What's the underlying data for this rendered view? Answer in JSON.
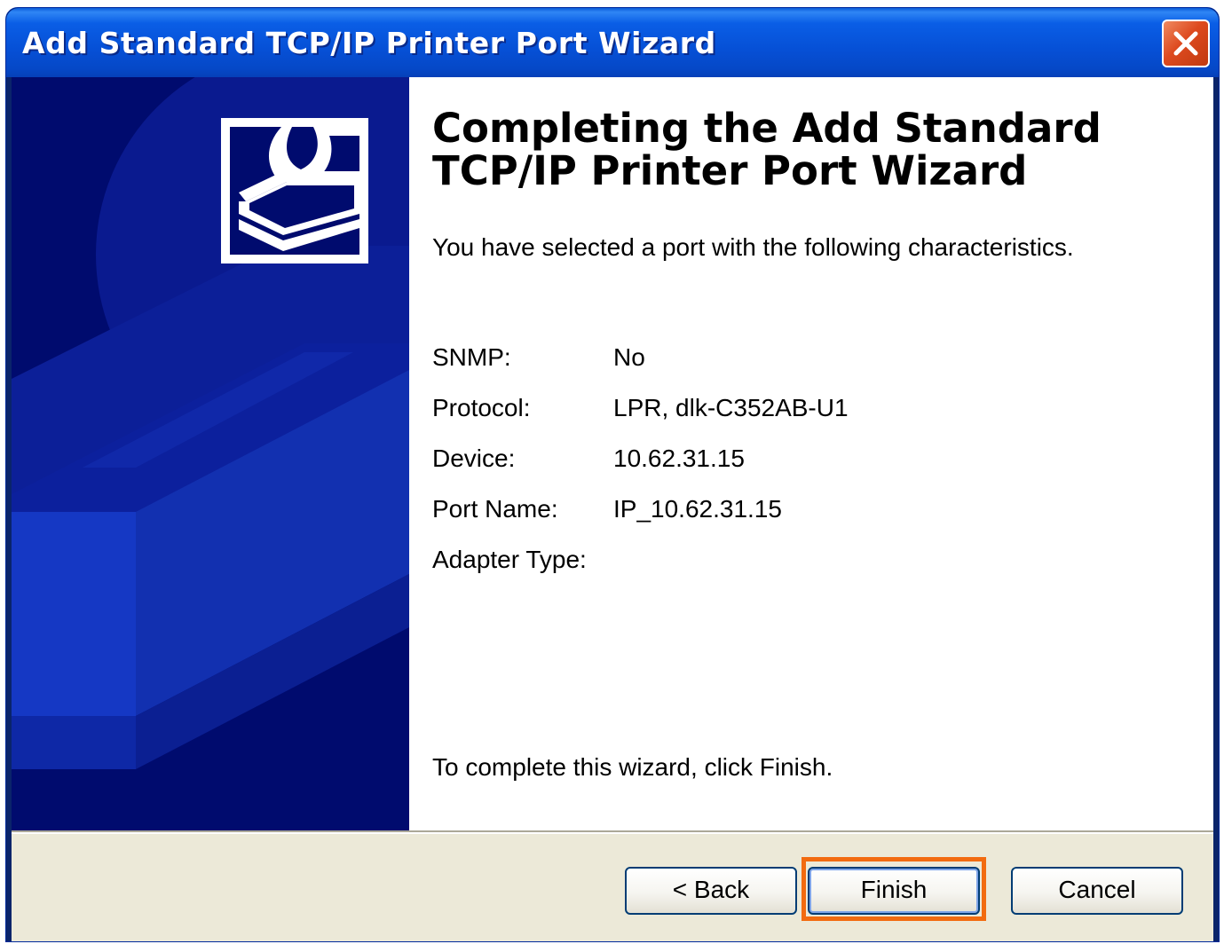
{
  "window": {
    "title": "Add Standard TCP/IP Printer Port Wizard",
    "close_icon": "close-x-icon"
  },
  "content": {
    "heading": "Completing the Add Standard TCP/IP Printer Port Wizard",
    "intro": "You have selected a port with the following characteristics.",
    "properties": [
      {
        "label": "SNMP:",
        "value": "No"
      },
      {
        "label": "Protocol:",
        "value": "LPR, dlk-C352AB-U1"
      },
      {
        "label": "Device:",
        "value": "10.62.31.15"
      },
      {
        "label": "Port Name:",
        "value": "IP_10.62.31.15"
      },
      {
        "label": "Adapter Type:",
        "value": ""
      }
    ],
    "finish_note": "To complete this wizard, click Finish."
  },
  "buttons": {
    "back": "< Back",
    "finish": "Finish",
    "cancel": "Cancel"
  },
  "colors": {
    "titlebar": "#0650d6",
    "side_panel": "#000b6e",
    "highlight": "#f26b10"
  }
}
